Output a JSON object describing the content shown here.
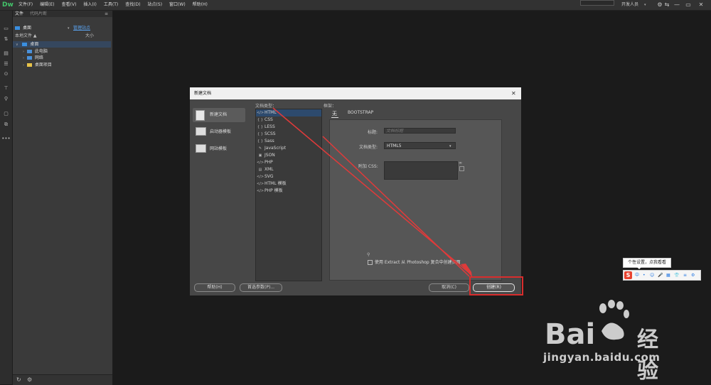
{
  "app": {
    "logo": "Dw"
  },
  "menubar": {
    "items": [
      "文件(F)",
      "编辑(E)",
      "查看(V)",
      "插入(I)",
      "工具(T)",
      "查找(D)",
      "站点(S)",
      "窗口(W)",
      "帮助(H)"
    ],
    "workspace": "开发人员",
    "workspace_arrow": "▾",
    "icons": {
      "settings": "⚙",
      "sync": "⇆",
      "minimize": "—",
      "maximize": "▭",
      "close": "✕"
    }
  },
  "files_panel": {
    "tabs": [
      "文件",
      "代码片断"
    ],
    "panel_menu": "≡",
    "site": "桌面",
    "manage_link": "管理站点",
    "col_local": "本地文件 ▲",
    "col_size": "大小",
    "tree": [
      {
        "label": "桌面",
        "arrow": "∨",
        "color": "#3a8fe0"
      },
      {
        "label": "此电脑",
        "arrow": "›",
        "color": "#4a90d9"
      },
      {
        "label": "网络",
        "arrow": "›",
        "color": "#4a90d9"
      },
      {
        "label": "桌面项目",
        "arrow": "›",
        "color": "#e8c34a"
      }
    ]
  },
  "dialog": {
    "title": "新建文档",
    "close": "✕",
    "nav": [
      "新建文档",
      "启动器模板",
      "网站模板"
    ],
    "doc_type_label": "文档类型：",
    "doc_types": [
      "HTML",
      "CSS",
      "LESS",
      "SCSS",
      "Sass",
      "JavaScript",
      "JSON",
      "PHP",
      "XML",
      "SVG",
      "HTML 模板",
      "PHP 模板"
    ],
    "framework_label": "框架：",
    "fw_tabs": [
      "无",
      "BOOTSTRAP"
    ],
    "title_label": "标题:",
    "title_placeholder": "文档标题",
    "doctype_label": "文档类型:",
    "doctype_value": "HTML5",
    "css_label": "附加 CSS:",
    "extract_label": "使用 Extract 从 Photoshop 复合中创建页面",
    "buttons": {
      "help": "帮助(H)",
      "pref": "首选参数(P)...",
      "cancel": "取消(C)",
      "create": "创建(R)"
    }
  },
  "ime": {
    "tip": "个性设置，点我看看",
    "logo": "S",
    "items": [
      "中",
      "•",
      "☺",
      "🎤",
      "▦",
      "👕",
      "≡",
      "⚙"
    ]
  },
  "watermark": {
    "bai": "Bai",
    "du": "经验",
    "url": "jingyan.baidu.com"
  },
  "colors": {
    "accent": "#2d4a6d",
    "highlight": "#d92d2d",
    "logo": "#43c46a"
  }
}
